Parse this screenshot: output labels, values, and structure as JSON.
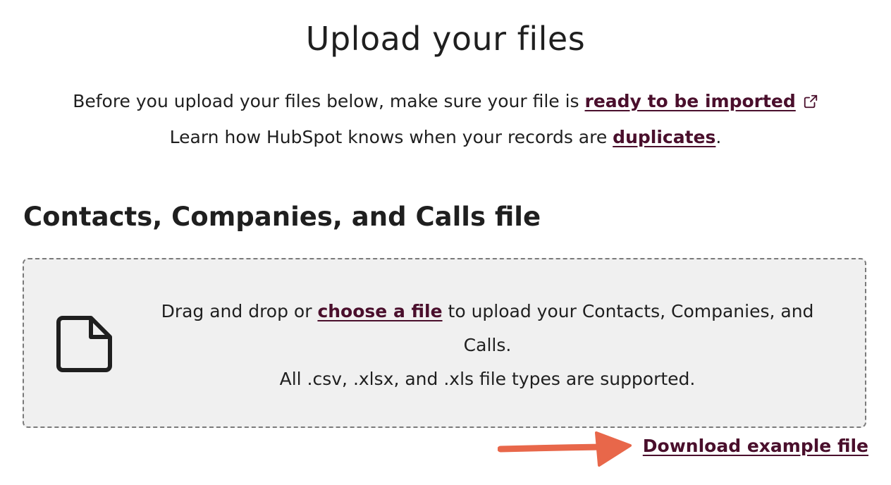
{
  "header": {
    "title": "Upload your files"
  },
  "intro": {
    "line1_prefix": "Before you upload your files below, make sure your file is ",
    "line1_link": "ready to be imported",
    "line2_prefix": "Learn how HubSpot knows when your records are ",
    "line2_link": "duplicates",
    "line2_suffix": "."
  },
  "section": {
    "title": "Contacts, Companies, and Calls file"
  },
  "dropzone": {
    "text_prefix": "Drag and drop or ",
    "choose_link": "choose a file",
    "text_suffix": " to upload your Contacts, Companies, and Calls.",
    "supported_types": "All .csv, .xlsx, and .xls file types are supported."
  },
  "download": {
    "link_label": "Download example file"
  },
  "colors": {
    "link": "#4a0f2c",
    "arrow": "#e8674a",
    "dropzone_bg": "#f0f0f0",
    "dropzone_border": "#7a7a7a"
  },
  "icons": {
    "external_link": "external-link-icon",
    "file": "file-icon",
    "arrow": "arrow-right-icon"
  }
}
